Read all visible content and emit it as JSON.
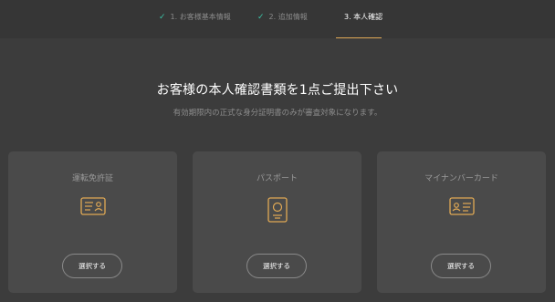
{
  "steps": [
    {
      "label": "1. お客様基本情報",
      "status": "done"
    },
    {
      "label": "2. 追加情報",
      "status": "done"
    },
    {
      "label": "3. 本人確認",
      "status": "active"
    }
  ],
  "heading": "お客様の本人確認書類を1点ご提出下さい",
  "subheading": "有効期限内の正式な身分証明書のみが審査対象になります。",
  "cards": [
    {
      "title": "運転免許証",
      "icon": "drivers-license-icon",
      "button": "選択する"
    },
    {
      "title": "パスポート",
      "icon": "passport-icon",
      "button": "選択する"
    },
    {
      "title": "マイナンバーカード",
      "icon": "id-card-icon",
      "button": "選択する"
    }
  ],
  "colors": {
    "background": "#3c3c3c",
    "card": "#4a4a4a",
    "accent": "#e0a955",
    "check": "#3bc4a8"
  }
}
